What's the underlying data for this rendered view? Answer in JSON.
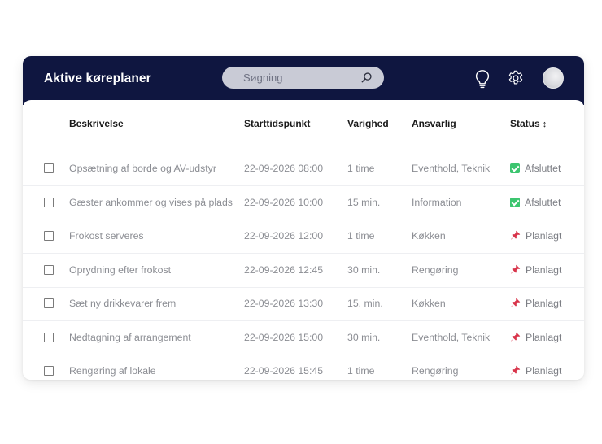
{
  "header": {
    "title": "Aktive køreplaner",
    "search_placeholder": "Søgning"
  },
  "columns": {
    "description": "Beskrivelse",
    "start": "Starttidspunkt",
    "duration": "Varighed",
    "responsible": "Ansvarlig",
    "status": "Status"
  },
  "rows": [
    {
      "description": "Opsætning af borde og AV-udstyr",
      "start": "22-09-2026 08:00",
      "duration": "1 time",
      "responsible": "Eventhold, Teknik",
      "status": "Afsluttet",
      "status_icon": "check-icon"
    },
    {
      "description": "Gæster ankommer og vises på plads",
      "start": "22-09-2026 10:00",
      "duration": "15 min.",
      "responsible": "Information",
      "status": "Afsluttet",
      "status_icon": "check-icon"
    },
    {
      "description": "Frokost serveres",
      "start": "22-09-2026 12:00",
      "duration": "1 time",
      "responsible": "Køkken",
      "status": "Planlagt",
      "status_icon": "pin-icon"
    },
    {
      "description": "Oprydning efter frokost",
      "start": "22-09-2026 12:45",
      "duration": "30 min.",
      "responsible": "Rengøring",
      "status": "Planlagt",
      "status_icon": "pin-icon"
    },
    {
      "description": "Sæt ny drikkevarer frem",
      "start": "22-09-2026 13:30",
      "duration": "15. min.",
      "responsible": "Køkken",
      "status": "Planlagt",
      "status_icon": "pin-icon"
    },
    {
      "description": "Nedtagning af arrangement",
      "start": "22-09-2026 15:00",
      "duration": "30 min.",
      "responsible": "Eventhold, Teknik",
      "status": "Planlagt",
      "status_icon": "pin-icon"
    },
    {
      "description": "Rengøring af lokale",
      "start": "22-09-2026 15:45",
      "duration": "1 time",
      "responsible": "Rengøring",
      "status": "Planlagt",
      "status_icon": "pin-icon"
    }
  ],
  "colors": {
    "header_bg": "#0f1640",
    "done": "#3cc56f",
    "planned": "#d8344a"
  }
}
